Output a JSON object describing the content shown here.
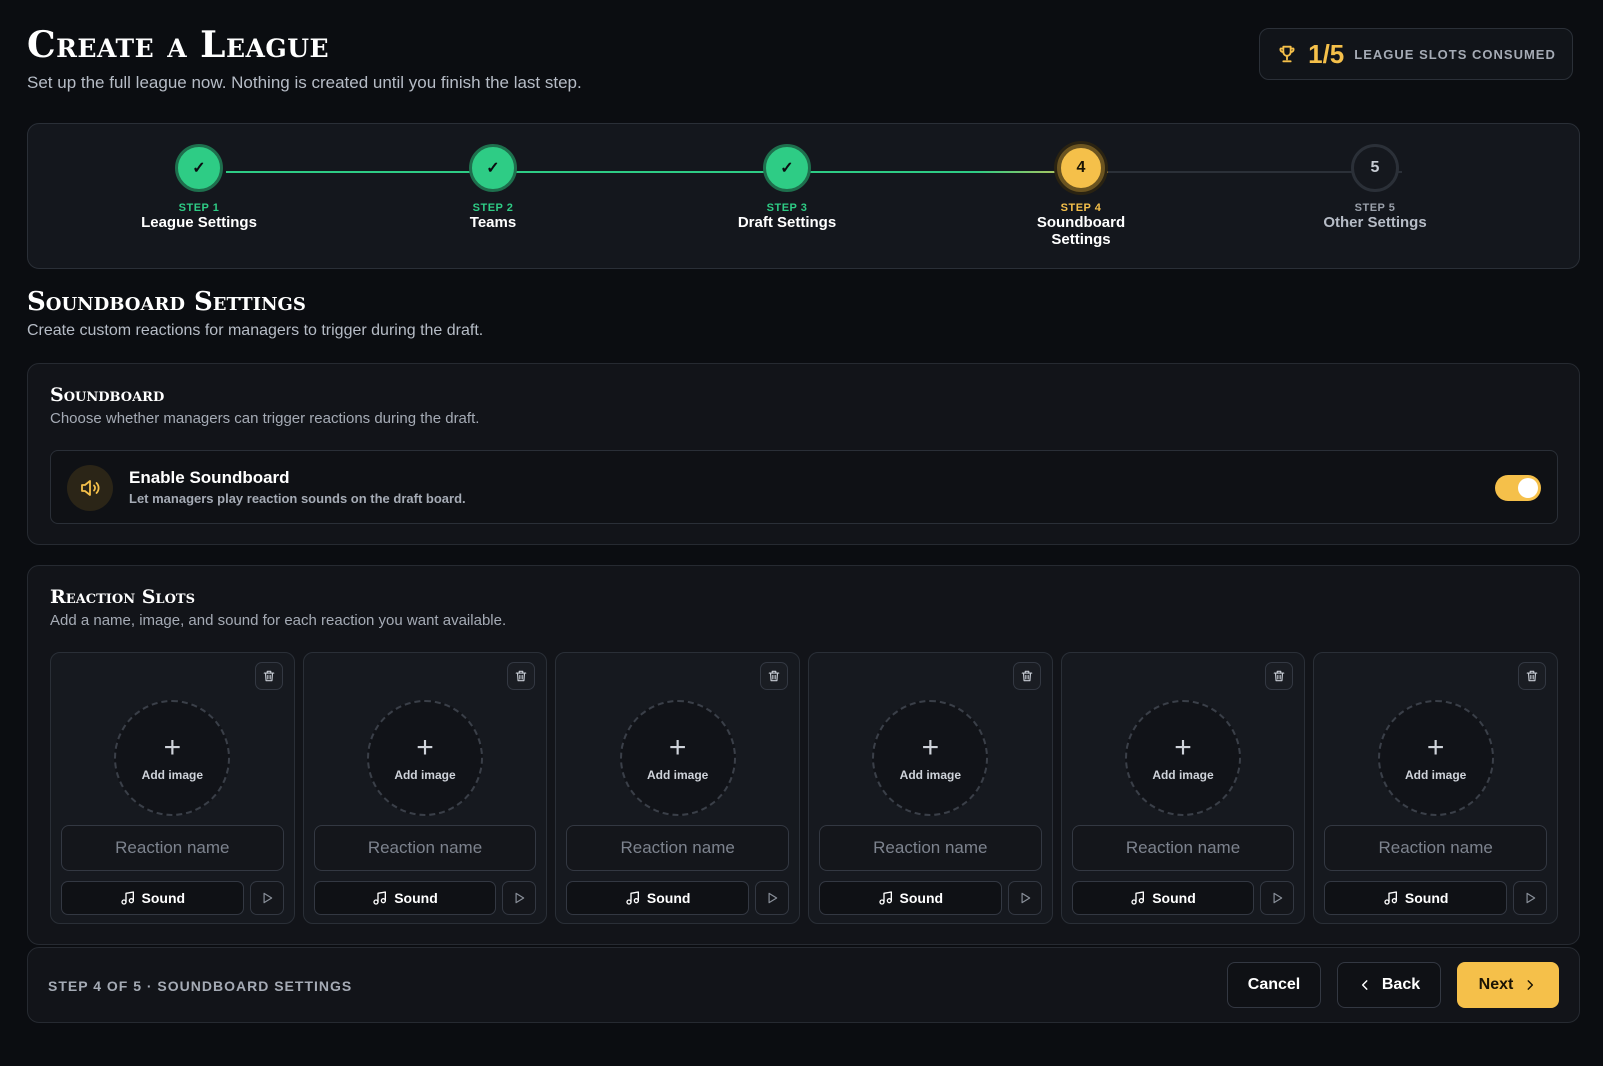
{
  "header": {
    "title": "Create a League",
    "subtitle": "Set up the full league now. Nothing is created until you finish the last step.",
    "slots_count": "1/5",
    "slots_label": "LEAGUE SLOTS CONSUMED"
  },
  "stepper": {
    "steps": [
      {
        "number": "STEP 1",
        "name": "League Settings",
        "status": "done",
        "indicator": "✓"
      },
      {
        "number": "STEP 2",
        "name": "Teams",
        "status": "done",
        "indicator": "✓"
      },
      {
        "number": "STEP 3",
        "name": "Draft Settings",
        "status": "done",
        "indicator": "✓"
      },
      {
        "number": "STEP 4",
        "name": "Soundboard Settings",
        "status": "current",
        "indicator": "4"
      },
      {
        "number": "STEP 5",
        "name": "Other Settings",
        "status": "todo",
        "indicator": "5"
      }
    ]
  },
  "section": {
    "title": "Soundboard Settings",
    "subtitle": "Create custom reactions for managers to trigger during the draft."
  },
  "soundboard": {
    "title": "Soundboard",
    "subtitle": "Choose whether managers can trigger reactions during the draft.",
    "toggle_title": "Enable Soundboard",
    "toggle_desc": "Let managers play reaction sounds on the draft board.",
    "enabled": true
  },
  "reactions": {
    "title": "Reaction Slots",
    "subtitle": "Add a name, image, and sound for each reaction you want available.",
    "slots": [
      {
        "add_image": "Add image",
        "name_placeholder": "Reaction name",
        "sound_label": "Sound"
      },
      {
        "add_image": "Add image",
        "name_placeholder": "Reaction name",
        "sound_label": "Sound"
      },
      {
        "add_image": "Add image",
        "name_placeholder": "Reaction name",
        "sound_label": "Sound"
      },
      {
        "add_image": "Add image",
        "name_placeholder": "Reaction name",
        "sound_label": "Sound"
      },
      {
        "add_image": "Add image",
        "name_placeholder": "Reaction name",
        "sound_label": "Sound"
      },
      {
        "add_image": "Add image",
        "name_placeholder": "Reaction name",
        "sound_label": "Sound"
      }
    ]
  },
  "footer": {
    "status": "STEP 4 OF 5 · SOUNDBOARD SETTINGS",
    "cancel_label": "Cancel",
    "back_label": "Back",
    "next_label": "Next"
  },
  "colors": {
    "accent": "#f5c04a",
    "success": "#2ecc85",
    "background": "#0b0d11"
  },
  "icons": [
    "trophy-icon",
    "check-icon",
    "speaker-icon",
    "trash-icon",
    "plus-icon",
    "music-note-icon",
    "play-icon",
    "chevron-left-icon",
    "chevron-right-icon"
  ]
}
